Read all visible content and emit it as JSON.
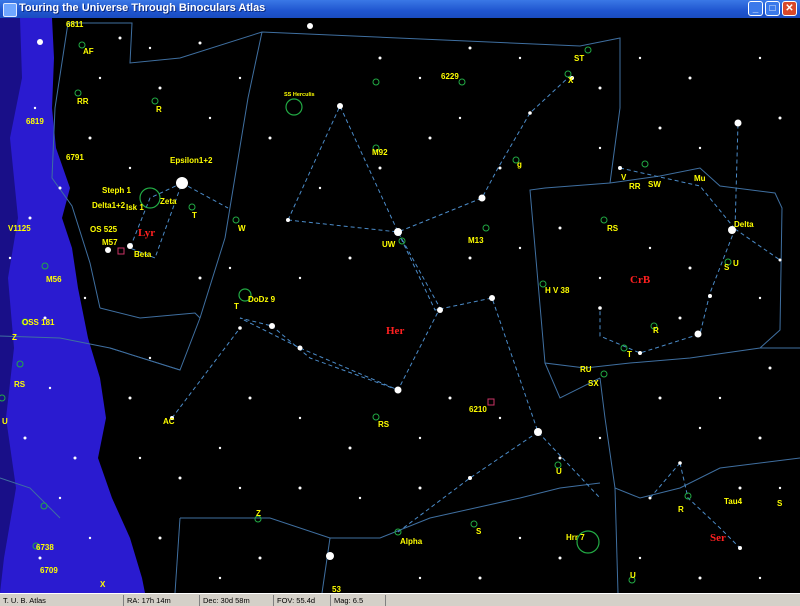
{
  "window": {
    "title": "Touring the Universe Through Binoculars Atlas",
    "min_label": "_",
    "max_label": "□",
    "close_label": "✕"
  },
  "colors": {
    "sky": "#000000",
    "milky_way": "#2a1bd0",
    "constellation_lines": "#3f6fa0",
    "object_labels": "#ffff00",
    "constellation_names": "#ff2020",
    "deep_sky_marker": "#22aa44"
  },
  "constellations": [
    "Lyr",
    "Her",
    "CrB",
    "Ser"
  ],
  "labels": [
    "6811",
    "AF",
    "RR",
    "R",
    "6819",
    "6791",
    "Epsilon1+2",
    "Steph 1",
    "Delta1+2",
    "Isk 1",
    "Zeta",
    "T",
    "V1125",
    "OS 525",
    "W",
    "M57",
    "Beta",
    "M56",
    "OSS 181",
    "Z",
    "RS",
    "U",
    "SS Herculis",
    "6229",
    "ST",
    "X",
    "M92",
    "g",
    "UW",
    "M13",
    "DoDz 9",
    "T",
    "V",
    "RR",
    "SW",
    "Mu",
    "RS",
    "Delta",
    "S",
    "U",
    "H V 38",
    "R",
    "T",
    "RU",
    "SX",
    "AC",
    "RS",
    "6210",
    "U",
    "Tau4",
    "R",
    "S",
    "Z",
    "6738",
    "6709",
    "X",
    "Alpha",
    "S",
    "Hrr 7",
    "U",
    "53"
  ],
  "status": {
    "app": "T. U. B. Atlas",
    "ra": "RA: 17h 14m",
    "dec": "Dec: 30d 58m",
    "fov": "FOV: 55.4d",
    "mag": "Mag: 6.5"
  }
}
